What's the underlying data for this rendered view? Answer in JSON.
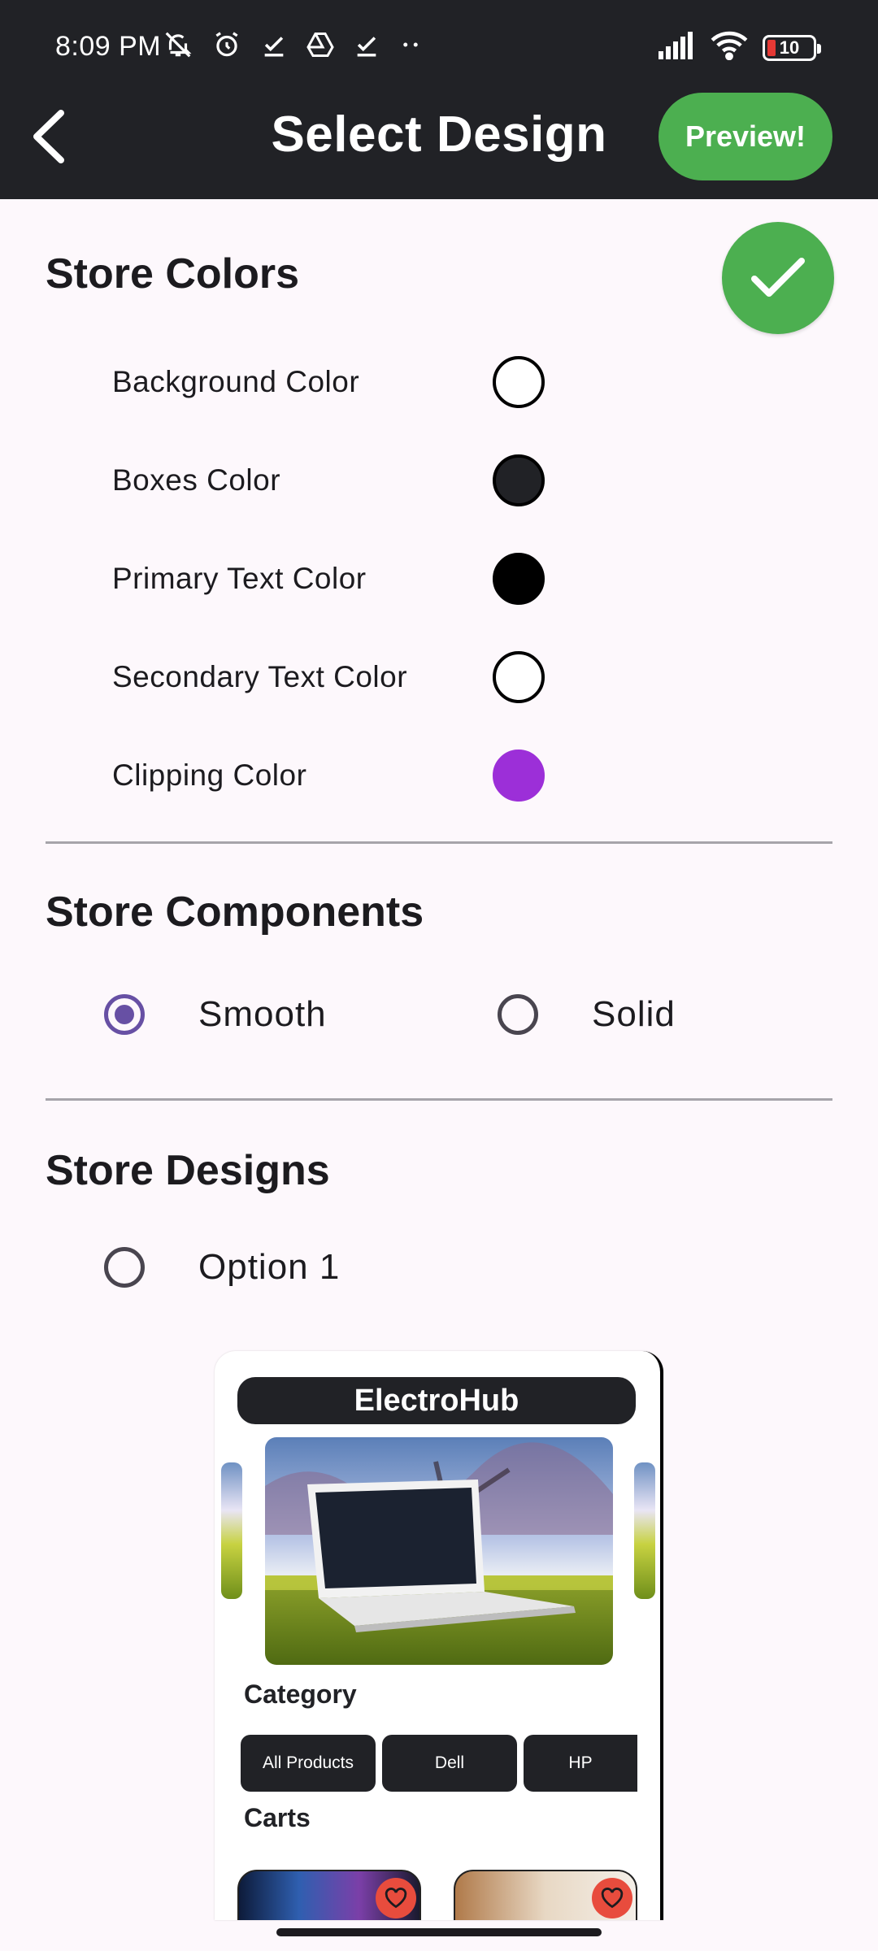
{
  "status_bar": {
    "time": "8:09 PM",
    "battery_level": "10",
    "left_icons": [
      "bell-off-icon",
      "alarm-icon",
      "check-icon",
      "drive-icon",
      "check-icon",
      "more-dots-icon"
    ],
    "right_icons": [
      "signal-icon",
      "wifi-icon",
      "battery-icon"
    ]
  },
  "app_bar": {
    "title": "Select Design",
    "preview_label": "Preview!"
  },
  "store_colors": {
    "title": "Store Colors",
    "items": [
      {
        "label": "Background Color",
        "color": "#ffffff"
      },
      {
        "label": "Boxes Color",
        "color": "#212226"
      },
      {
        "label": "Primary Text Color",
        "color": "#000000"
      },
      {
        "label": "Secondary Text Color",
        "color": "#ffffff"
      },
      {
        "label": "Clipping Color",
        "color": "#9c2fd8"
      }
    ]
  },
  "store_components": {
    "title": "Store Components",
    "options": [
      {
        "label": "Smooth",
        "selected": true
      },
      {
        "label": "Solid",
        "selected": false
      }
    ]
  },
  "store_designs": {
    "title": "Store Designs",
    "options": [
      {
        "label": "Option 1",
        "selected": false
      }
    ],
    "preview": {
      "store_name": "ElectroHub",
      "category_heading": "Category",
      "chips": [
        "All Products",
        "Dell",
        "HP"
      ],
      "carts_heading": "Carts"
    }
  },
  "colors": {
    "accent_green": "#4caf50",
    "radio_selected": "#6750a4",
    "app_bar_bg": "#212226",
    "heart_red": "#e84c3d"
  }
}
